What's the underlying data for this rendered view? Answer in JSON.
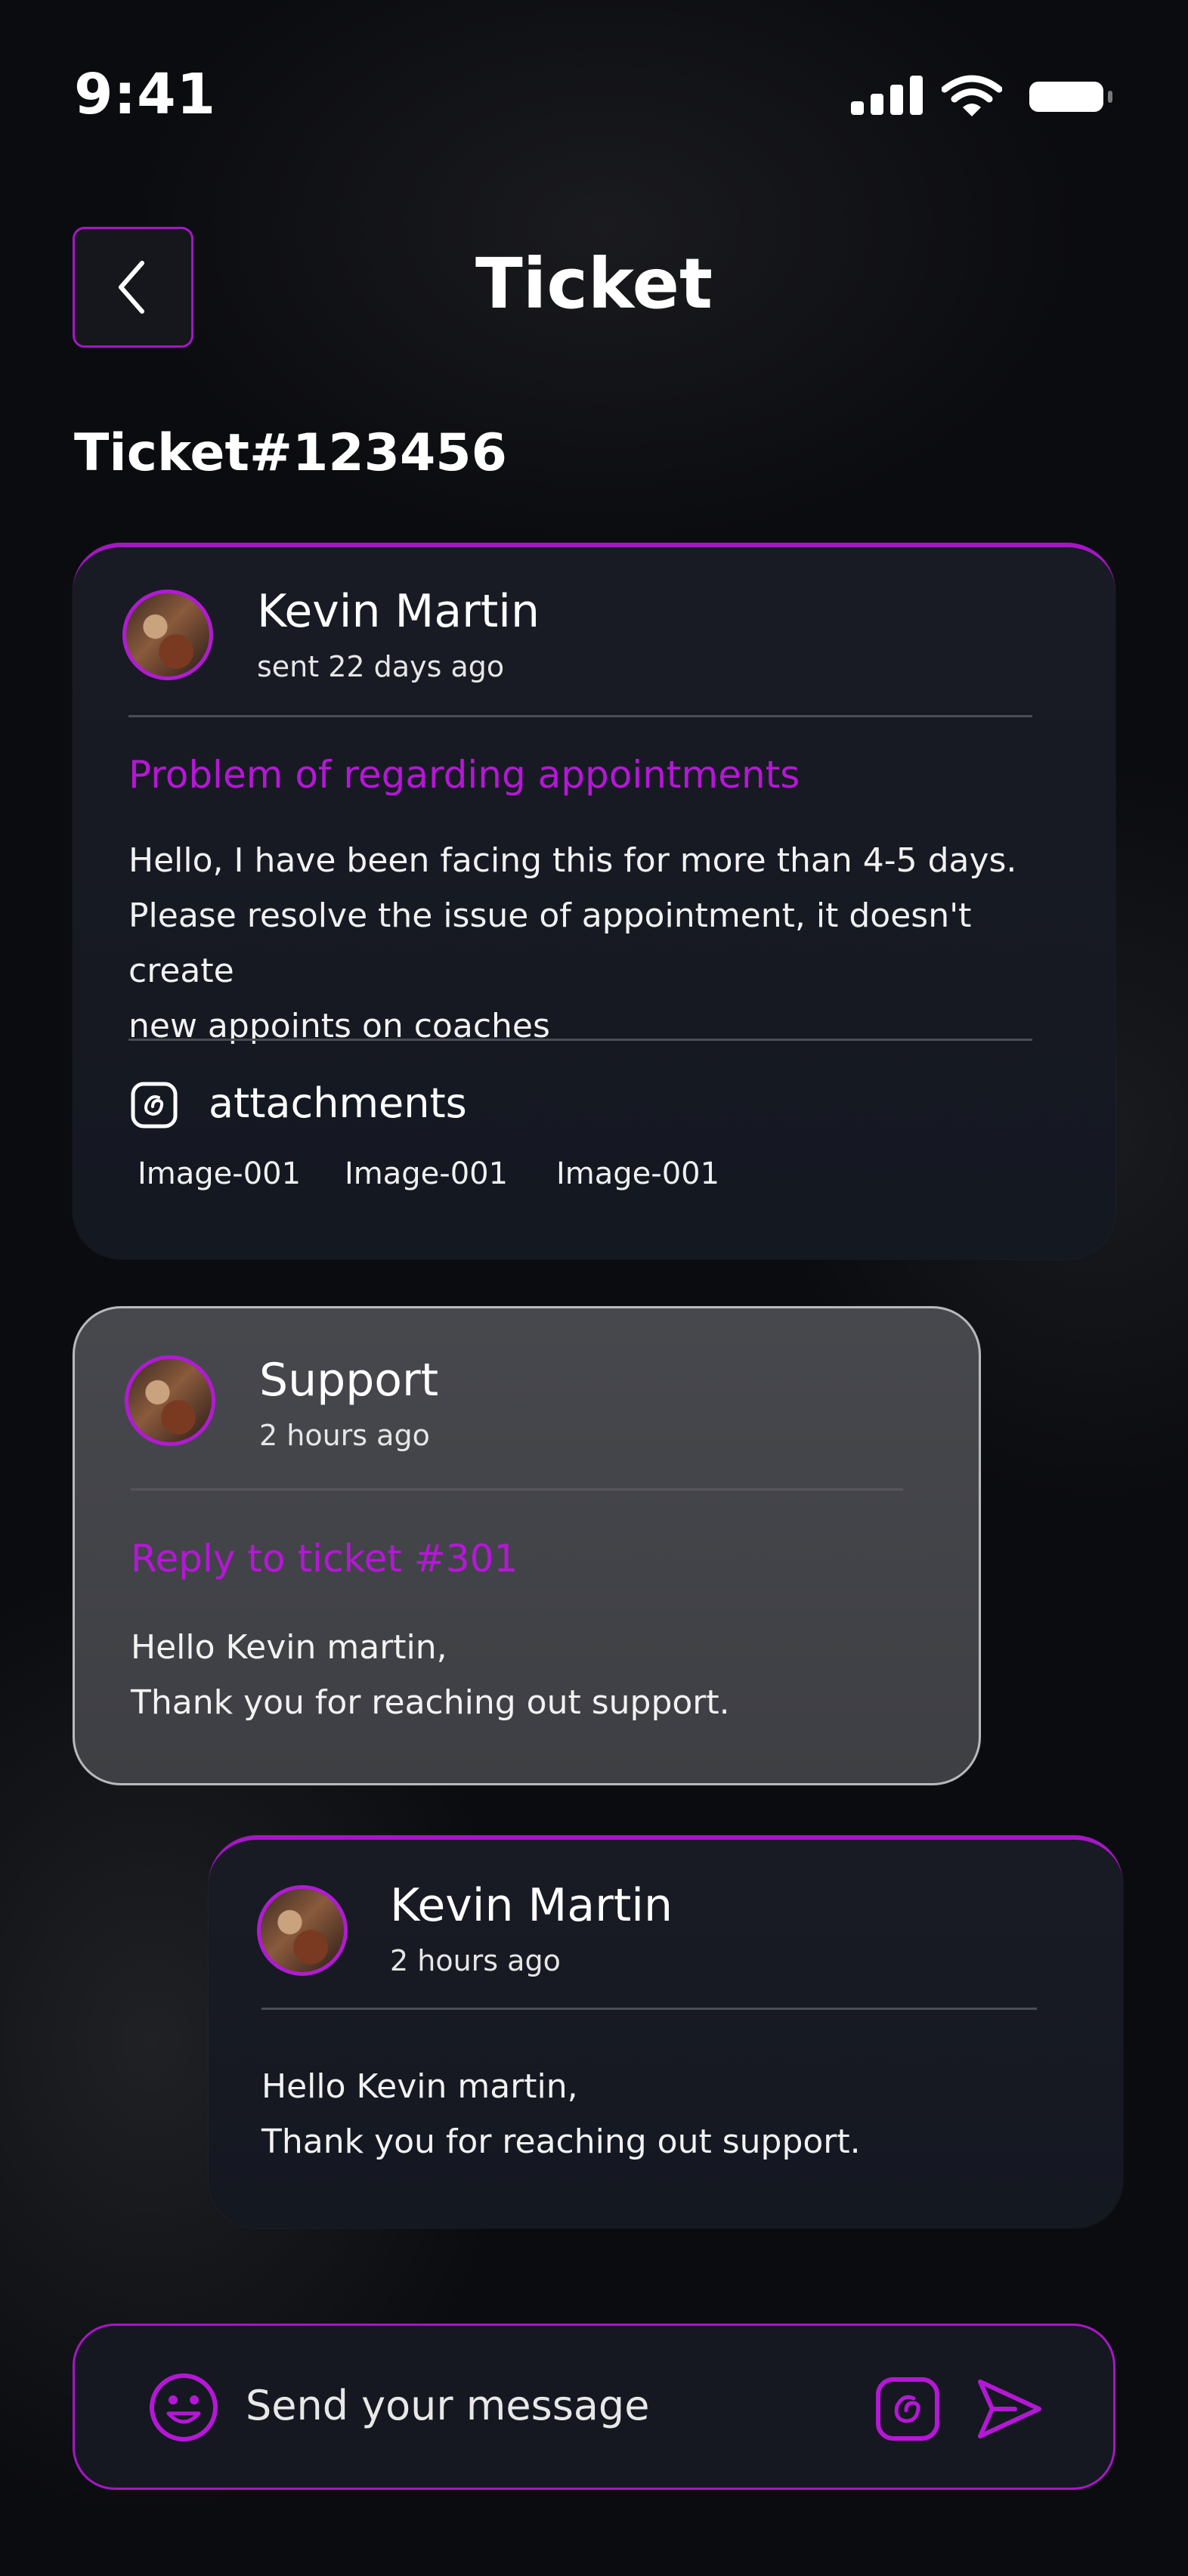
{
  "status_bar": {
    "time": "9:41"
  },
  "header": {
    "title": "Ticket"
  },
  "ticket": {
    "number": "Ticket#123456"
  },
  "messages": [
    {
      "author": "Kevin Martin",
      "time": "sent 22 days ago",
      "subject": "Problem of regarding appointments",
      "body": [
        "Hello, I have been facing this for more than 4-5 days.",
        "Please resolve the issue of appointment, it doesn't create",
        "new appoints on coaches"
      ],
      "attachments_label": "attachments",
      "attachments": [
        "Image-001",
        "Image-001",
        "Image-001"
      ]
    },
    {
      "author": "Support",
      "time": "2 hours ago",
      "subject": "Reply to ticket #301",
      "body": [
        "Hello Kevin martin,",
        "Thank you for reaching out support."
      ]
    },
    {
      "author": "Kevin Martin",
      "time": "2 hours ago",
      "body": [
        "Hello Kevin martin,",
        "Thank you for reaching out support."
      ]
    }
  ],
  "composer": {
    "placeholder": "Send your message"
  },
  "icons": {
    "back": "chevron-left-icon",
    "attach": "attachment-icon",
    "emoji": "smiley-icon",
    "send": "send-icon"
  },
  "colors": {
    "accent": "#a616c6",
    "background": "#0b0c0f",
    "card": "#171a22",
    "support_card": "#444549"
  }
}
